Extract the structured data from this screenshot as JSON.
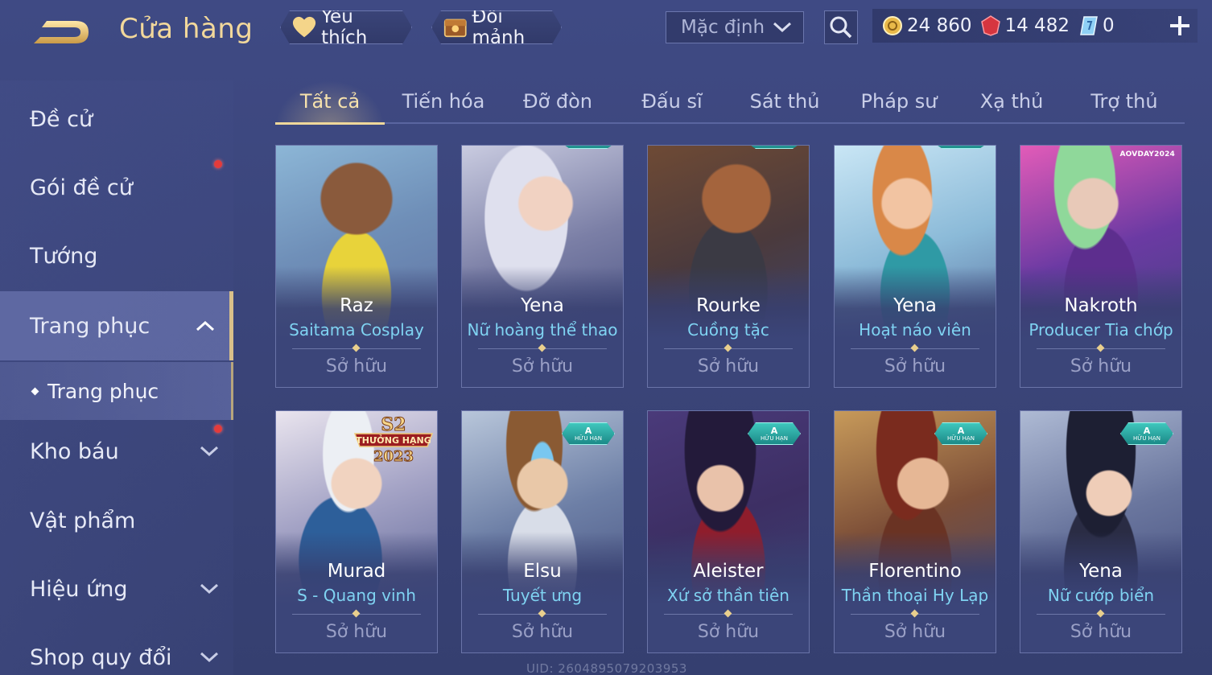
{
  "header": {
    "title": "Cửa hàng",
    "favorites_label": "Yêu thích",
    "exchange_label": "Đổi mảnh",
    "sort": {
      "selected": "Mặc định"
    },
    "currencies": [
      {
        "name": "gold-coin",
        "value": "24 860"
      },
      {
        "name": "red-gem",
        "value": "14 482"
      },
      {
        "name": "voucher",
        "value": "0"
      }
    ]
  },
  "sidebar": {
    "items": [
      {
        "label": "Đề cử"
      },
      {
        "label": "Gói đề cử"
      },
      {
        "label": "Tướng"
      },
      {
        "label": "Trang phục"
      },
      {
        "label": "Kho báu"
      },
      {
        "label": "Vật phẩm"
      },
      {
        "label": "Hiệu ứng"
      },
      {
        "label": "Shop quy đổi"
      }
    ],
    "sub_item": "Trang phục"
  },
  "tabs": [
    "Tất cả",
    "Tiến hóa",
    "Đỡ đòn",
    "Đấu sĩ",
    "Sát thủ",
    "Pháp sư",
    "Xạ thủ",
    "Trợ thủ"
  ],
  "cards": [
    {
      "hero": "Raz",
      "skin": "Saitama Cosplay",
      "status": "Sở hữu"
    },
    {
      "hero": "Yena",
      "skin": "Nữ hoàng thể thao",
      "status": "Sở hữu"
    },
    {
      "hero": "Rourke",
      "skin": "Cuồng tặc",
      "status": "Sở hữu"
    },
    {
      "hero": "Yena",
      "skin": "Hoạt náo viên",
      "status": "Sở hữu"
    },
    {
      "hero": "Nakroth",
      "skin": "Producer Tia chớp",
      "status": "Sở hữu"
    },
    {
      "hero": "Murad",
      "skin": "S - Quang vinh",
      "status": "Sở hữu"
    },
    {
      "hero": "Elsu",
      "skin": "Tuyết ưng",
      "status": "Sở hữu"
    },
    {
      "hero": "Aleister",
      "skin": "Xứ sở thần tiên",
      "status": "Sở hữu"
    },
    {
      "hero": "Florentino",
      "skin": "Thần thoại Hy Lạp",
      "status": "Sở hữu"
    },
    {
      "hero": "Yena",
      "skin": "Nữ cướp biển",
      "status": "Sở hữu"
    }
  ],
  "badges": {
    "tier": "A",
    "limited": "HỮU HẠN",
    "event": "AOVDAY2024",
    "rank_line1": "S2",
    "rank_line2": "THƯỞNG HẠNG",
    "rank_line3": "2023"
  },
  "watermark": "UID: 2604895079203953",
  "colors": {
    "accent": "#f0d89a",
    "skin_name": "#7fd3f2",
    "badge": "#3fc7bd",
    "alert": "#e43b3b"
  }
}
